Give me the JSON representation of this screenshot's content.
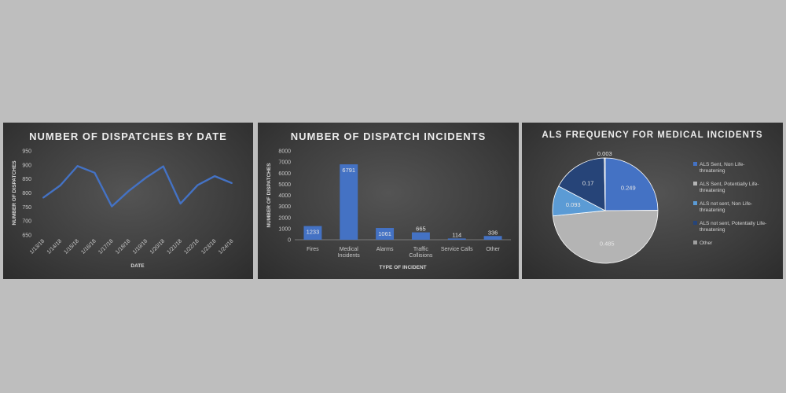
{
  "chart_data": [
    {
      "type": "line",
      "title": "NUMBER OF DISPATCHES BY DATE",
      "xlabel": "DATE",
      "ylabel": "NUMBER OF DISPATCHES",
      "x": [
        "1/13/18",
        "1/14/18",
        "1/15/18",
        "1/16/18",
        "1/17/18",
        "1/18/18",
        "1/19/18",
        "1/20/18",
        "1/21/18",
        "1/22/18",
        "1/23/18",
        "1/24/18"
      ],
      "series": [
        {
          "values": [
            783,
            827,
            896,
            872,
            752,
            808,
            855,
            895,
            762,
            828,
            860,
            835
          ]
        }
      ],
      "yticks": [
        650,
        700,
        750,
        800,
        850,
        900,
        950
      ],
      "ylim": [
        650,
        950
      ],
      "grid": false,
      "color": "#4472c4"
    },
    {
      "type": "bar",
      "title": "NUMBER OF DISPATCH INCIDENTS",
      "xlabel": "TYPE OF INCIDENT",
      "ylabel": "NUMBER OF DISPATCHES",
      "categories": [
        [
          "Fires"
        ],
        [
          "Medical",
          "Incidents"
        ],
        [
          "Alarms"
        ],
        [
          "Traffic",
          "Collisions"
        ],
        [
          "Service Calls"
        ],
        [
          "Other"
        ]
      ],
      "values": [
        1233,
        6791,
        1061,
        665,
        114,
        336
      ],
      "labels": [
        "1233",
        "6791",
        "1061",
        "665",
        "114",
        "336"
      ],
      "yticks": [
        0,
        1000,
        2000,
        3000,
        4000,
        5000,
        6000,
        7000,
        8000
      ],
      "ylim": [
        0,
        8000
      ],
      "grid": false,
      "color": "#4472c4"
    },
    {
      "type": "pie",
      "title": "ALS FREQUENCY FOR MEDICAL INCIDENTS",
      "slices": [
        {
          "legend": [
            "ALS Sent, Non Life-",
            "threatening"
          ],
          "value": 0.249,
          "label": "0.249",
          "color": "#4472c4"
        },
        {
          "legend": [
            "ALS Sent, Potentially Life-",
            "threatening"
          ],
          "value": 0.485,
          "label": "0.485",
          "color": "#b4b4b4"
        },
        {
          "legend": [
            "ALS not sent, Non Life-",
            "threatening"
          ],
          "value": 0.093,
          "label": "0.093",
          "color": "#5b9bd5"
        },
        {
          "legend": [
            "ALS not sent, Potentially Life-",
            "threatening"
          ],
          "value": 0.17,
          "label": "0.17",
          "color": "#264478"
        },
        {
          "legend": [
            "Other"
          ],
          "value": 0.003,
          "label": "0.003",
          "color": "#9e9e9e"
        }
      ],
      "draw_order": [
        0,
        1,
        2,
        3,
        4
      ],
      "legend_position": "right"
    }
  ]
}
